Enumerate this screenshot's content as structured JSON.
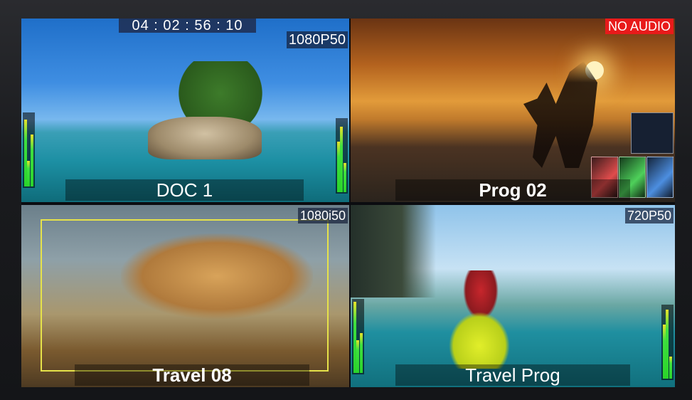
{
  "multiviewer": {
    "q1": {
      "timecode": "04 : 02 : 56 : 10",
      "format": "1080P50",
      "label": "DOC 1"
    },
    "q2": {
      "alert": "NO AUDIO",
      "label": "Prog 02"
    },
    "q3": {
      "format": "1080i50",
      "label": "Travel 08"
    },
    "q4": {
      "format": "720P50",
      "label": "Travel Prog"
    }
  },
  "colors": {
    "alert_bg": "#e81a1a",
    "safe_box": "#e6e24a",
    "meter_green": "#2bd42b",
    "meter_yellow": "#e8e22a"
  },
  "audio_levels": {
    "q1_left": [
      0.92,
      0.35,
      0.72
    ],
    "q1_right": [
      0.7,
      0.9,
      0.4
    ],
    "q4_left": [
      0.98,
      0.45,
      0.55
    ],
    "q4_right": [
      0.75,
      0.95,
      0.3
    ]
  }
}
